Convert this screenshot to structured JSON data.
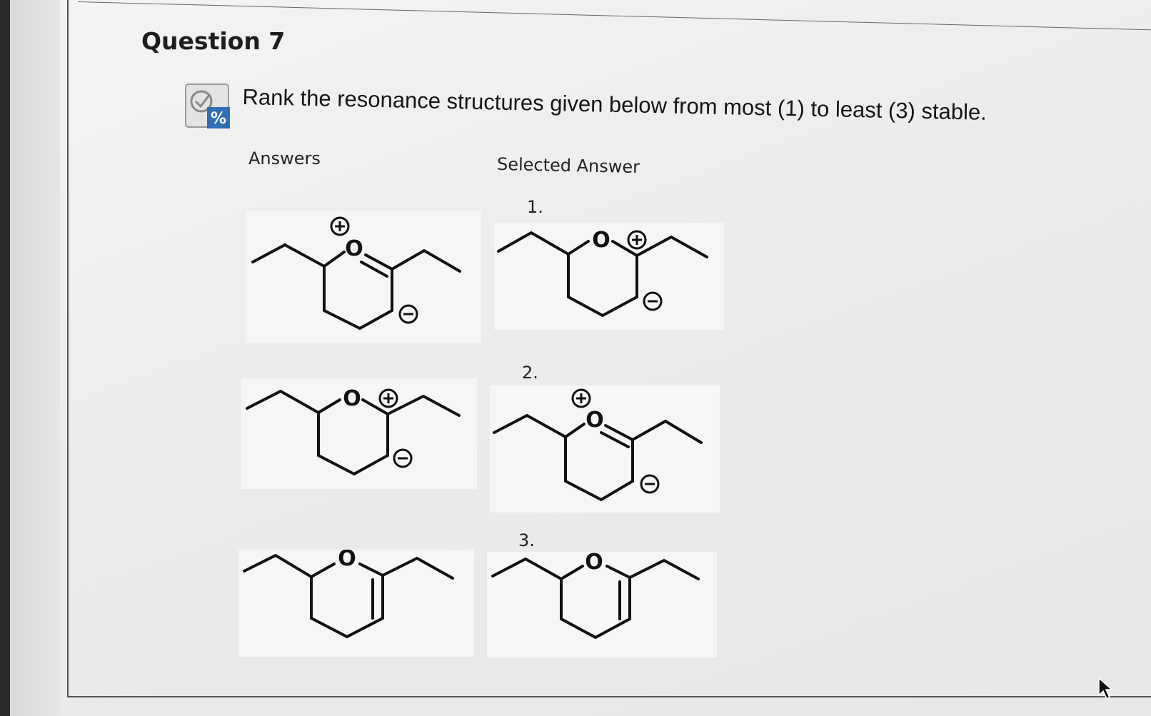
{
  "question": {
    "title": "Question 7",
    "prompt": "Rank the resonance structures given below from most (1) to least (3) stable.",
    "type_icon": "check-percent-icon"
  },
  "columns": {
    "answers_label": "Answers",
    "selected_label": "Selected Answer"
  },
  "selected_ranks": [
    "1.",
    "2.",
    "3."
  ],
  "atoms": {
    "oxygen": "O"
  },
  "icons": {
    "plus_charge": "plus-charge-icon",
    "minus_charge": "minus-charge-icon",
    "cursor": "arrow-cursor-icon"
  },
  "colors": {
    "accent_blue": "#2f6db5",
    "ink": "#111111",
    "tile_bg": "#f6f6f6"
  }
}
